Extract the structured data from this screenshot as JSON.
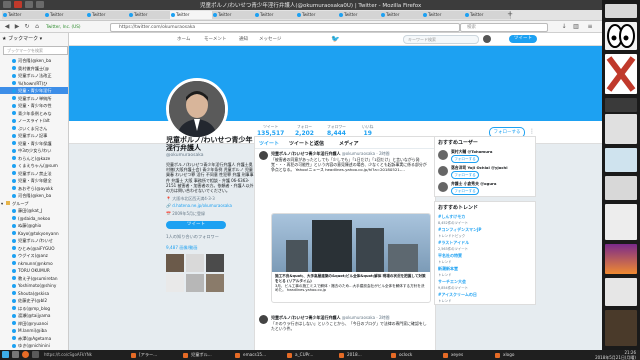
{
  "window": {
    "title": "児童ポルノ/わいせつ青少年淫行弁護人(@okumuraosaka0U) | Twitter - Mozilla Firefox"
  },
  "tabs": [
    {
      "label": "Twitter"
    },
    {
      "label": "Twitter"
    },
    {
      "label": "Twitter"
    },
    {
      "label": "Twitter"
    },
    {
      "label": "Twitter"
    },
    {
      "label": "Twitter"
    },
    {
      "label": "Twitter"
    },
    {
      "label": "Twitter"
    },
    {
      "label": "Twitter"
    },
    {
      "label": "Twitter"
    },
    {
      "label": "Twitter"
    },
    {
      "label": "Twitter"
    }
  ],
  "navbar": {
    "url": "https://twitter.com/okumuraosaka",
    "identity": "Twitter, Inc. (US)",
    "search_placeholder": "検索"
  },
  "sidebar": {
    "title": "ブックマーク",
    "search_placeholder": "ブックマークを検索",
    "items": [
      {
        "label": "河合隆(@ken_ba"
      },
      {
        "label": "奥村徹弁護士(@"
      },
      {
        "label": "児童ポルノ法改正"
      },
      {
        "label": "%(hown/RT)ひ"
      },
      {
        "label": "児童・青少年淫行"
      },
      {
        "label": "児童ポルノ単純所"
      },
      {
        "label": "児童・青少年の性"
      },
      {
        "label": "青少年条例とみな"
      },
      {
        "label": "ノースライト/alt"
      },
      {
        "label": "ぶいくま兄さん"
      },
      {
        "label": "児童ポルノ記事"
      },
      {
        "label": "児童・青少年保護"
      },
      {
        "label": "中3の少女ら/わい"
      },
      {
        "label": "わらんと(@kaze"
      },
      {
        "label": "くまえちゃん(@sum"
      },
      {
        "label": "児童ポルノ禁止法"
      },
      {
        "label": "児童・青少年健全"
      },
      {
        "label": "あおぞら(@ayokk"
      },
      {
        "label": "河合隆(@ken_ba"
      }
    ],
    "group_label": "グループ",
    "group_items": [
      {
        "label": "藤田(@kat_J"
      },
      {
        "label": "(@daida_nekoo"
      },
      {
        "label": "ぬ藤(@ghio"
      },
      {
        "label": "Kayo(@tokyonyann"
      },
      {
        "label": "児童ポルノ/わいせ"
      },
      {
        "label": "ひとみ(@aiFYGUO"
      },
      {
        "label": "ウグイス(@anz"
      },
      {
        "label": "nkmunn(@nkmo"
      },
      {
        "label": "TORU OKUMUR"
      },
      {
        "label": "教え子(@sumiretan"
      },
      {
        "label": "Yoshimoto(@shiny"
      },
      {
        "label": "Shouta(@skisa"
      },
      {
        "label": "佐藤史子(@bl2"
      },
      {
        "label": "はる(@mp_blog"
      },
      {
        "label": "渡瀬(@taijyama"
      },
      {
        "label": "岸田(@ryuanoi"
      },
      {
        "label": "M.Ianmi(@iba"
      },
      {
        "label": "赤澤(@Agetama"
      },
      {
        "label": "ゆき(@nichinini"
      },
      {
        "label": "とわ(@sa_beta"
      },
      {
        "label": "坂本(@ohama_k"
      }
    ]
  },
  "twitter_header": {
    "home": "ホーム",
    "moments": "モーメント",
    "notifications": "通知",
    "messages": "メッセージ",
    "search_placeholder": "キーワード検索",
    "tweet_button": "ツイート"
  },
  "profile": {
    "name": "児童ポルノ/わいせつ青少年淫行弁護人",
    "handle": "@okumuraosaka",
    "bio": "児童ポルノ/わいせつ青少年淫行弁護人 弁護士奥村徹(大阪弁護士会) 青少年条例 児童ポルノ 児童買春 わいせつ罪 淫行 不同意 性犯罪 弁護 刑事事件 弁護士 大阪 事務所で相談・弁護 06-6363-2151 被害者・加害者の方。依頼者・弁護人以外の方は問い合わせないでください。",
    "location": "大阪市北区西天満4-3-3",
    "link": "d.hatena.ne.jp/okumuraosaka",
    "joined": "2009年5月に登録",
    "tweet_button": "ツイート",
    "followers_you_know": "1人の知り合いのフォロワー",
    "photos_label": "9,487 画像/動画"
  },
  "stats": {
    "tweets_label": "ツイート",
    "tweets_value": "135,517",
    "following_label": "フォロー",
    "following_value": "2,202",
    "followers_label": "フォロワー",
    "followers_value": "8,444",
    "likes_label": "いいね",
    "likes_value": "19",
    "follow_button": "フォローする"
  },
  "timeline": {
    "tabs": [
      "ツイート",
      "ツイートと返信",
      "メディア"
    ],
    "tweets": [
      {
        "author": "児童ポルノ/わいせつ青少年淫行弁護人",
        "handle": "@okumuraosaka · 2時間",
        "body": "「被害者の同意があったとしても「少しでも」「1日だけ」「1回だけ」と言いながら発覚・・・再犯の可能性」という内容の意見陳述の場合、少なくとも起訴事実に係る部分が争点となる。 Yahoo!ニュース headlines.yahoo.co.jp/hl?a=20180521-..."
      },
      {
        "author": "児童ポルノ/わいせつ青少年淫行弁護人",
        "handle": "@okumuraosaka · 2時間",
        "body": "「キのウラ行きはしない」ということから、「今日のブログ」で法律の専門家に確認をしたという件。"
      }
    ],
    "card_title": "施工不良&quot;、大手高層建築の&quot;ビル全体&quot;解体 現場の状況を把握して対策をとる (リアルタイム)",
    "card_body": "3月、ビル工事の施工ミスで解体・撤去のため...大手建設会社がビル全体を解体する方針を決めた。 headlines.yahoo.co.jp"
  },
  "suggestions": {
    "title": "おすすめユーザー",
    "users": [
      {
        "name": "東村大輔 @Tohomura",
        "button": "フォローする"
      },
      {
        "name": "落合洋司 Yoji Ochiai @yjochi",
        "button": "フォローする"
      },
      {
        "name": "弁護士 小倉秀夫 @ogura",
        "button": "フォローする"
      }
    ]
  },
  "trends": {
    "title": "おすすめトレンド",
    "items": [
      {
        "tag": "#しんすけモカ",
        "desc": "8,452件のツイート"
      },
      {
        "tag": "#コンフィデンスマンJP",
        "desc": "トレンドトピック"
      },
      {
        "tag": "#ラストアイドル",
        "desc": "2,563件のツイート"
      },
      {
        "tag": "平名社の特質",
        "desc": "トレンド"
      },
      {
        "tag": "新潮新本堂",
        "desc": "トレンド"
      },
      {
        "tag": "サーチエン大会",
        "desc": "9,854件のツイート"
      },
      {
        "tag": "#アイスクリームの日",
        "desc": "トレンド"
      }
    ]
  },
  "taskbar": {
    "items": [
      {
        "label": "[アラー..."
      },
      {
        "label": "児童ポル..."
      },
      {
        "label": "emacs15..."
      },
      {
        "label": "a_CUPr..."
      },
      {
        "label": "2018..."
      },
      {
        "label": "oclock"
      },
      {
        "label": "xeyes"
      },
      {
        "label": "xlogo"
      }
    ],
    "status": "https://t.co/cSgoAFkYNk",
    "time": "21:26",
    "date": "2018年5月21日(月曜)"
  }
}
